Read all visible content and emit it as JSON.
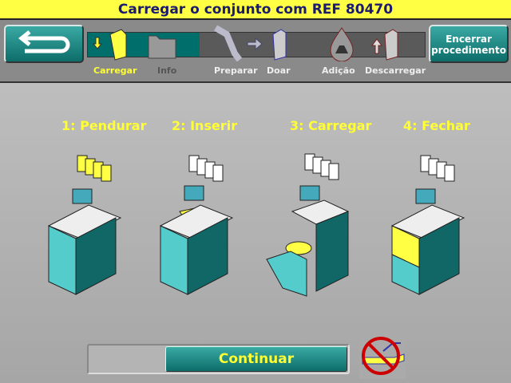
{
  "title": "Carregar o conjunto com REF 80470",
  "toolbar": {
    "back_icon": "return-arrow-icon",
    "end_label": "Encerrar procedimento",
    "progress_steps": [
      {
        "label": "Carregar",
        "state": "current",
        "icon": "load-machine-icon"
      },
      {
        "label": "Info",
        "state": "pending",
        "icon": "folder-icon"
      },
      {
        "label": "Preparar",
        "state": "pending",
        "icon": "donor-chair-icon"
      },
      {
        "label": "Doar",
        "state": "pending",
        "icon": "machine-icon"
      },
      {
        "label": "Adição",
        "state": "pending",
        "icon": "drop-flask-icon"
      },
      {
        "label": "Descarregar",
        "state": "pending",
        "icon": "unload-machine-icon"
      }
    ]
  },
  "steps": [
    "1: Pendurar",
    "2: Inserir",
    "3: Carregar",
    "4: Fechar"
  ],
  "continue_label": "Continuar",
  "colors": {
    "accent": "#0d6d69",
    "highlight": "#ffff33",
    "title_bg": "#ffff44"
  }
}
